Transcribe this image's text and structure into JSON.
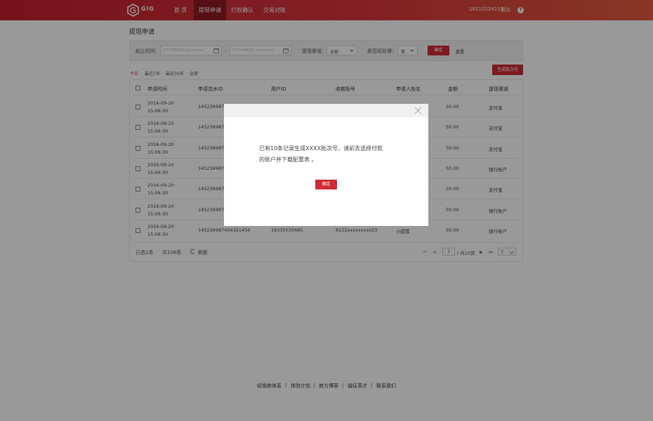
{
  "header": {
    "logo_text": "GIG",
    "nav": [
      "首 页",
      "提现申请",
      "打款确认",
      "交易对账"
    ],
    "active_nav": "提现申请",
    "phone": "18210224213",
    "logout": "退出",
    "help": "?",
    "accent_color": "#c4202e",
    "active_color": "#8f1a22"
  },
  "page": {
    "title": "提现申请"
  },
  "filters": {
    "time_label": "起止时间：",
    "start_placeholder": "YYYY/MM/DD hh:mm:ss",
    "end_placeholder": "YYYY/MM/DD hh:mm:ss",
    "dash": "-",
    "channel_label": "提现渠道：",
    "channel_value": "全部",
    "processed_label": "是否经处理：",
    "processed_value": "否",
    "confirm": "确定",
    "reset": "重置"
  },
  "quick_ranges": [
    "今日",
    "最近7天",
    "最近30天",
    "全部"
  ],
  "generate_batch": "生成批次号",
  "table": {
    "headers": [
      "申请时间",
      "申请流水ID",
      "用户ID",
      "收款账号",
      "申请人姓名",
      "金额",
      "提现渠道"
    ],
    "rows": [
      {
        "date": "2016-09-20",
        "time": "15:06:30",
        "serial": "14523698745",
        "user": "",
        "account": "",
        "name": "",
        "amount": "50.00",
        "channel": "支付宝"
      },
      {
        "date": "2016-09-20",
        "time": "15:06:30",
        "serial": "14523698745",
        "user": "",
        "account": "",
        "name": "",
        "amount": "50.00",
        "channel": "支付宝"
      },
      {
        "date": "2016-09-20",
        "time": "15:06:30",
        "serial": "14523698745",
        "user": "",
        "account": "",
        "name": "",
        "amount": "50.00",
        "channel": "支付宝"
      },
      {
        "date": "2016-09-20",
        "time": "15:06:30",
        "serial": "14523698745",
        "user": "",
        "account": "",
        "name": "",
        "amount": "50.00",
        "channel": "银行账户"
      },
      {
        "date": "2016-09-20",
        "time": "15:06:30",
        "serial": "14523698745",
        "user": "",
        "account": "",
        "name": "",
        "amount": "50.00",
        "channel": "支付宝"
      },
      {
        "date": "2016-09-20",
        "time": "15:06:30",
        "serial": "14523698745",
        "user": "",
        "account": "",
        "name": "",
        "amount": "50.00",
        "channel": "银行账户"
      },
      {
        "date": "2016-09-20",
        "time": "15:06:30",
        "serial": "145236987456321456",
        "user": "18335035685",
        "account": "6222xxxxxxxxx23",
        "name": "小提提",
        "amount": "50.00",
        "channel": "银行账户"
      }
    ]
  },
  "table_footer": {
    "selected": "已选1条",
    "total": "共106条",
    "refresh": "刷新",
    "page": "1",
    "page_total": "/ 共10页",
    "page_size": "7"
  },
  "site_footer": [
    "经销商体系",
    "体验计划",
    "官方博客",
    "诚征英才",
    "联系我们"
  ],
  "site_footer_sep": "|",
  "modal": {
    "message_line1": "已有10条记录生成XXXX批次号，请前去选择付款",
    "message_line2": "的账户并下载配置表 。",
    "ok": "确定"
  }
}
